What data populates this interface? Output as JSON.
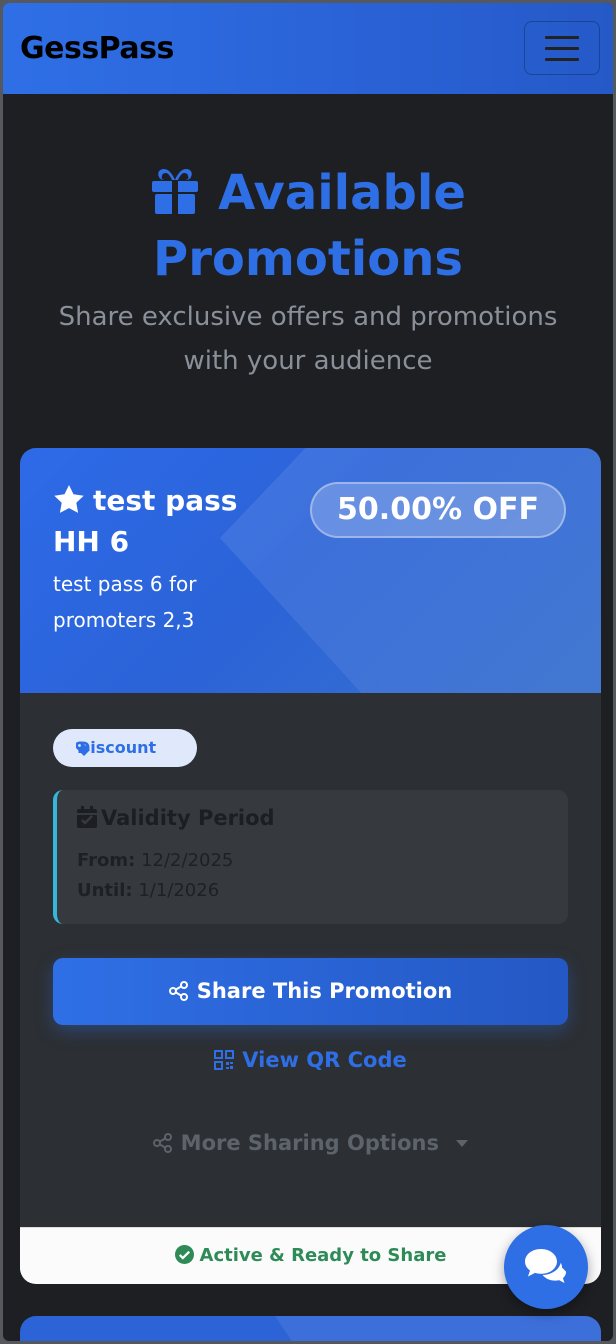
{
  "navbar": {
    "brand": "GessPass",
    "menu_icon": "hamburger-menu-icon"
  },
  "hero": {
    "icon": "gift-icon",
    "title": "Available Promotions",
    "subtitle": "Share exclusive offers and promotions with your audience"
  },
  "promotion": {
    "title_icon": "star-icon",
    "title": "test pass HH 6",
    "description": "test pass 6 for promoters 2,3",
    "discount": "50.00% OFF",
    "type_label": "Discount",
    "validity": {
      "heading": "Validity Period",
      "from_label": "From:",
      "from_value": "12/2/2025",
      "until_label": "Until:",
      "until_value": "1/1/2026"
    },
    "share_button": "Share This Promotion",
    "qr_link": "View QR Code",
    "more_options": "More Sharing Options",
    "status": "Active & Ready to Share"
  },
  "colors": {
    "accent": "#2f6fe6",
    "background": "#1d1f23",
    "card": "#2c2f33",
    "status_green": "#2e8b57",
    "validity_border": "#37b6d9"
  },
  "chat": {
    "icon": "chat-bubbles-icon"
  }
}
